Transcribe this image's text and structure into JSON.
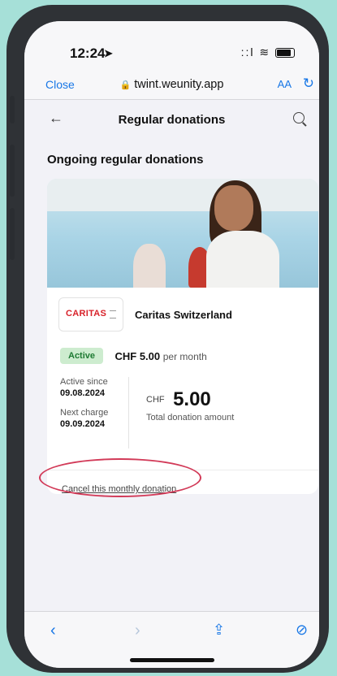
{
  "status_bar": {
    "time": "12:24",
    "signal": "::l",
    "wifi": "wifi-icon"
  },
  "browser": {
    "close_label": "Close",
    "url": "twint.weunity.app",
    "aa_label": "AA",
    "reload_icon": "reload-icon"
  },
  "app_header": {
    "title": "Regular donations"
  },
  "section": {
    "title": "Ongoing regular donations"
  },
  "donation": {
    "org_logo_text": "CARITAS",
    "org_name": "Caritas Switzerland",
    "status": "Active",
    "amount_line": "CHF 5.00",
    "per_label": "per month",
    "active_since_label": "Active since",
    "active_since": "09.08.2024",
    "next_charge_label": "Next charge",
    "next_charge": "09.09.2024",
    "currency": "CHF",
    "total_amount": "5.00",
    "total_label": "Total donation amount",
    "cancel_label": "Cancel this monthly donation"
  },
  "colors": {
    "accent": "#1877e6",
    "active_badge_bg": "#cdeccf",
    "active_badge_text": "#1d7a32",
    "highlight": "#d23a58",
    "brand_red": "#d8222a"
  }
}
